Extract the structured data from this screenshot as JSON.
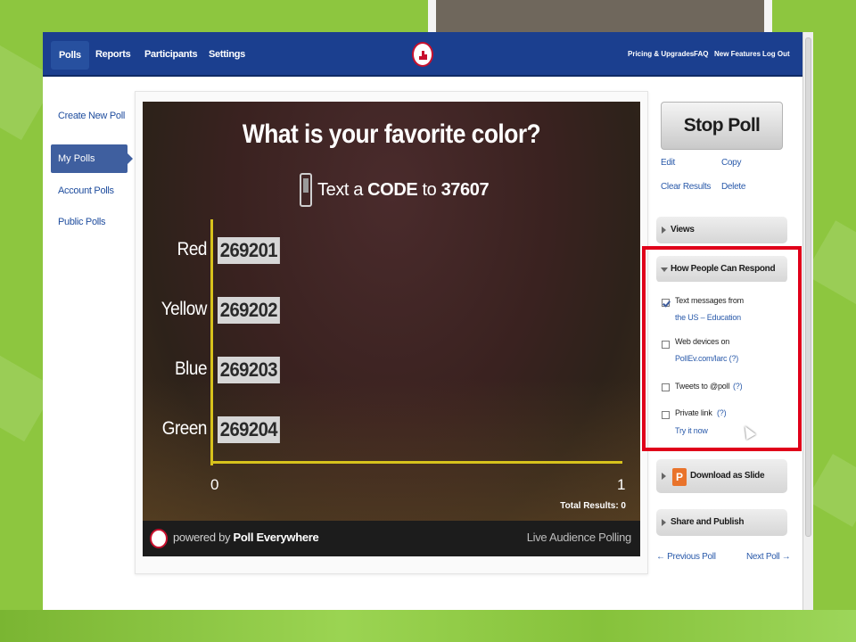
{
  "topnav": {
    "items": [
      "Polls",
      "Reports",
      "Participants",
      "Settings"
    ],
    "right": [
      "Pricing & Upgrades",
      "FAQ",
      "New Features",
      "Log Out"
    ]
  },
  "sidebar": {
    "items": [
      "Create New Poll",
      "My Polls",
      "Account Polls",
      "Public Polls"
    ]
  },
  "poll": {
    "question": "What is your favorite color?",
    "instruction_prefix": "Text a",
    "instruction_code": "CODE",
    "instruction_mid": "to",
    "instruction_number": "37607",
    "options": [
      {
        "label": "Red",
        "code": "269201"
      },
      {
        "label": "Yellow",
        "code": "269202"
      },
      {
        "label": "Blue",
        "code": "269203"
      },
      {
        "label": "Green",
        "code": "269204"
      }
    ],
    "axis_min": "0",
    "axis_max": "1",
    "total_results": "Total Results: 0",
    "footer_powered": "powered by",
    "footer_brand": "Poll Everywhere",
    "footer_right": "Live Audience Polling"
  },
  "actions": {
    "stop": "Stop Poll",
    "edit": "Edit",
    "copy": "Copy",
    "clear": "Clear Results",
    "delete": "Delete"
  },
  "panels": {
    "views": "Views",
    "respond": "How People Can Respond",
    "download": "Download as Slide",
    "share": "Share and Publish"
  },
  "respond_options": {
    "text_label": "Text messages from",
    "text_link": "the US – Education",
    "web_label": "Web devices on",
    "web_link": "PollEv.com/larc (?)",
    "tweet_label": "Tweets to @poll",
    "tweet_link": "(?)",
    "private_label": "Private link",
    "private_help": "(?)",
    "private_link": "Try it now"
  },
  "pager": {
    "prev": "← Previous Poll",
    "next": "Next Poll →"
  },
  "colors": {
    "nav": "#1b3f8f",
    "highlight": "#e0001a",
    "axis": "#d7c21c",
    "slide_bg": "#8dc63f"
  }
}
